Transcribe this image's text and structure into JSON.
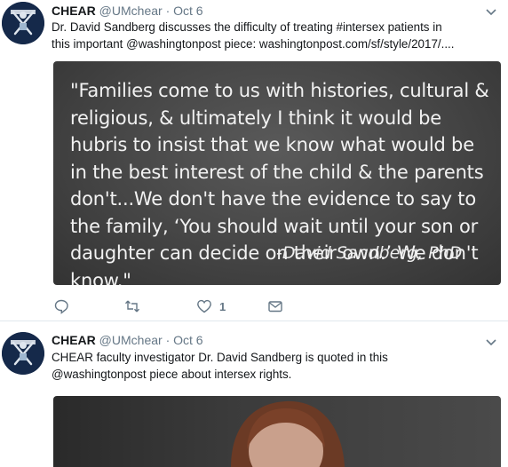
{
  "tweets": [
    {
      "name": "CHEAR",
      "handle_time": "@UMchear · Oct 6",
      "text_line1": "Dr. David Sandberg discusses the difficulty of treating #intersex patients in",
      "text_line2": "this important @washingtonpost piece: washingtonpost.com/sf/style/2017/....",
      "quote": "\"Families come to us with histories, cultural & religious, & ultimately I think it would be hubris to insist that we know what would be in the best interest of the child & the parents don't...We don't have the evidence to say to the family, ‘You should wait until your son or daughter can decide on their own.’ We don't know.\"",
      "attribution": "-David Sandberg, PhD",
      "like_count": "1"
    },
    {
      "name": "CHEAR",
      "handle_time": "@UMchear · Oct 6",
      "text_line1": "CHEAR faculty investigator Dr. David Sandberg is quoted in this",
      "text_line2": "@washingtonpost piece about intersex rights."
    }
  ],
  "icons": [
    "reply-icon",
    "retweet-icon",
    "like-icon",
    "message-icon",
    "chevron-down-icon"
  ],
  "colors": {
    "icon": "#657786",
    "avatar_bg": "#15294a",
    "quote_bg": "#454545"
  }
}
